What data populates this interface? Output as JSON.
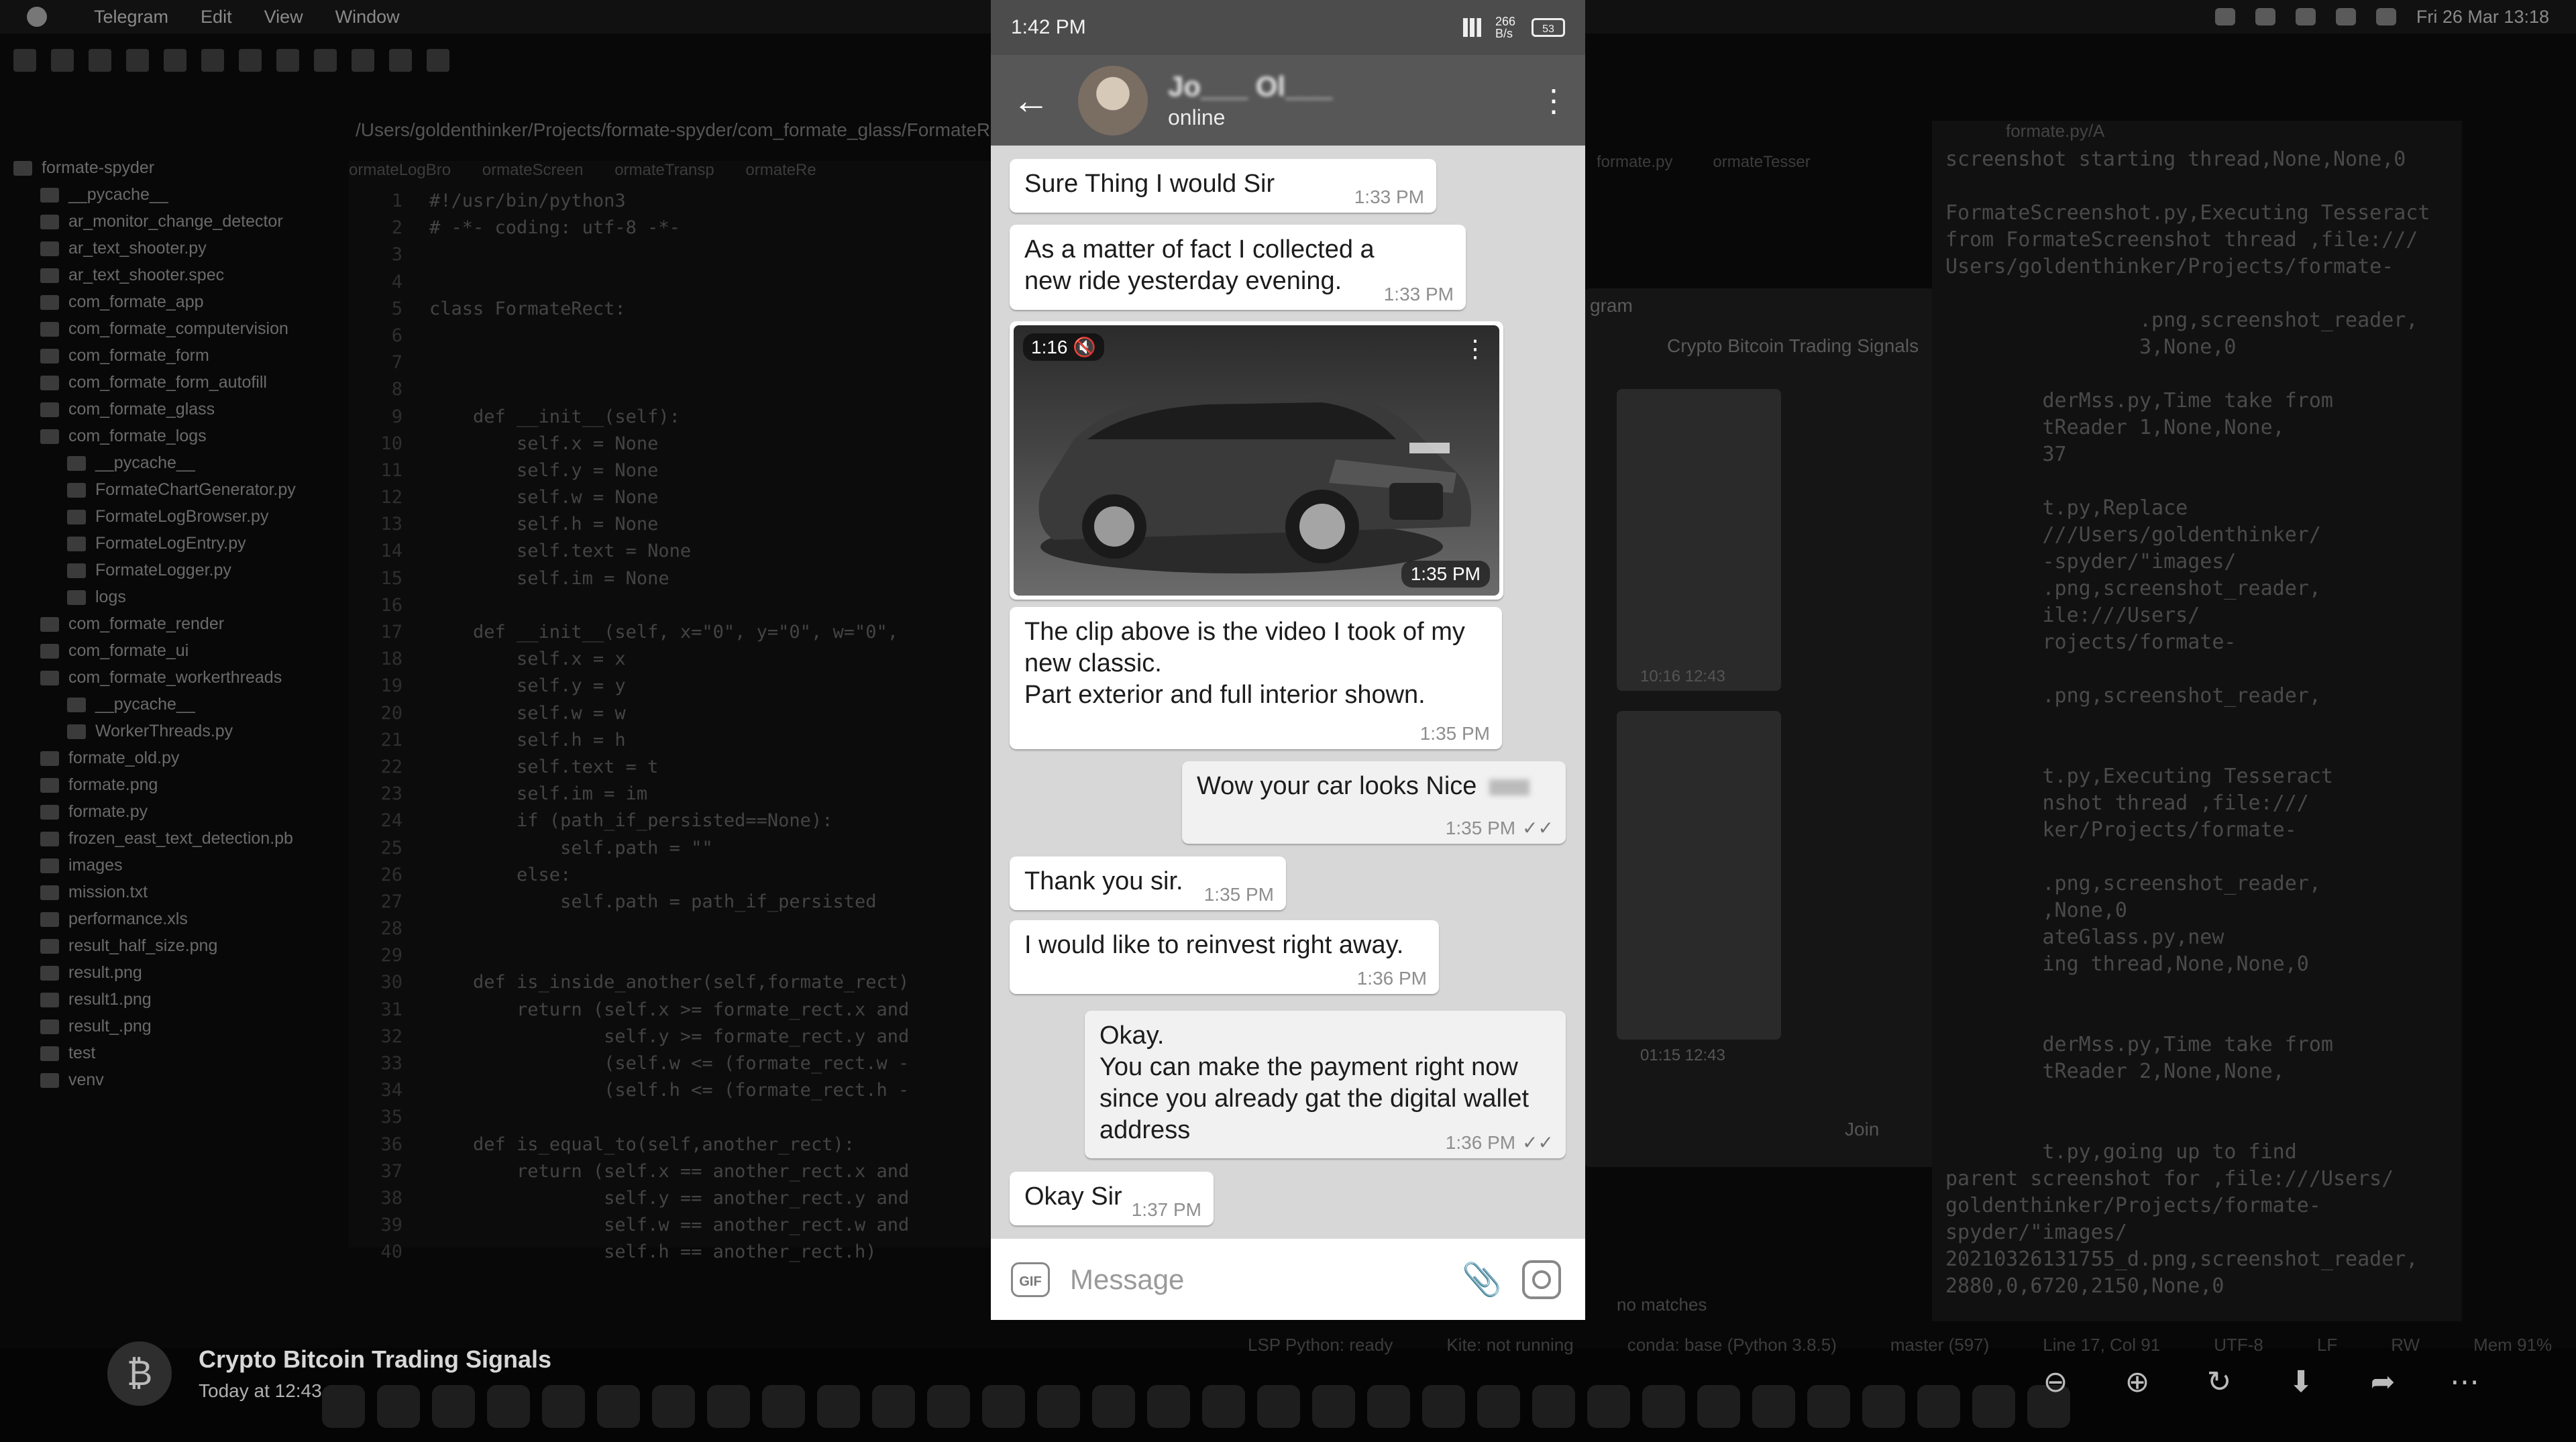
{
  "menubar": {
    "app": "Telegram",
    "items": [
      "Edit",
      "View",
      "Window"
    ],
    "clock": "Fri 26 Mar 13:18"
  },
  "ide": {
    "path": "/Users/goldenthinker/Projects/formate-spyder/com_formate_glass/FormateRe",
    "project_tree": [
      "formate-spyder",
      "__pycache__",
      "ar_monitor_change_detector",
      "ar_text_shooter.py",
      "ar_text_shooter.spec",
      "com_formate_app",
      "com_formate_computervision",
      "com_formate_form",
      "com_formate_form_autofill",
      "com_formate_glass",
      "com_formate_logs",
      "__pycache__",
      "FormateChartGenerator.py",
      "FormateLogBrowser.py",
      "FormateLogEntry.py",
      "FormateLogger.py",
      "logs",
      "com_formate_render",
      "com_formate_ui",
      "com_formate_workerthreads",
      "__pycache__",
      "WorkerThreads.py",
      "formate_old.py",
      "formate.png",
      "formate.py",
      "frozen_east_text_detection.pb",
      "images",
      "mission.txt",
      "performance.xls",
      "result_half_size.png",
      "result.png",
      "result1.png",
      "result_.png",
      "test",
      "venv"
    ],
    "editor_tabs": [
      "ormateLogBro",
      "ormateScreen",
      "ormateTransp",
      "ormateRe"
    ],
    "editor_lines": [
      [
        "1",
        "#!/usr/bin/python3"
      ],
      [
        "2",
        "# -*- coding: utf-8 -*-"
      ],
      [
        "3",
        ""
      ],
      [
        "4",
        ""
      ],
      [
        "5",
        "class FormateRect:"
      ],
      [
        "6",
        ""
      ],
      [
        "7",
        ""
      ],
      [
        "8",
        ""
      ],
      [
        "9",
        "    def __init__(self):"
      ],
      [
        "10",
        "        self.x = None"
      ],
      [
        "11",
        "        self.y = None"
      ],
      [
        "12",
        "        self.w = None"
      ],
      [
        "13",
        "        self.h = None"
      ],
      [
        "14",
        "        self.text = None"
      ],
      [
        "15",
        "        self.im = None"
      ],
      [
        "16",
        ""
      ],
      [
        "17",
        "    def __init__(self, x=\"0\", y=\"0\", w=\"0\","
      ],
      [
        "18",
        "        self.x = x"
      ],
      [
        "19",
        "        self.y = y"
      ],
      [
        "20",
        "        self.w = w"
      ],
      [
        "21",
        "        self.h = h"
      ],
      [
        "22",
        "        self.text = t"
      ],
      [
        "23",
        "        self.im = im"
      ],
      [
        "24",
        "        if (path_if_persisted==None):"
      ],
      [
        "25",
        "            self.path = \"\""
      ],
      [
        "26",
        "        else:"
      ],
      [
        "27",
        "            self.path = path_if_persisted"
      ],
      [
        "28",
        ""
      ],
      [
        "29",
        ""
      ],
      [
        "30",
        "    def is_inside_another(self,formate_rect)"
      ],
      [
        "31",
        "        return (self.x >= formate_rect.x and"
      ],
      [
        "32",
        "                self.y >= formate_rect.y and"
      ],
      [
        "33",
        "                (self.w <= (formate_rect.w -"
      ],
      [
        "34",
        "                (self.h <= (formate_rect.h -"
      ],
      [
        "35",
        ""
      ],
      [
        "36",
        "    def is_equal_to(self,another_rect):"
      ],
      [
        "37",
        "        return (self.x == another_rect.x and"
      ],
      [
        "38",
        "                self.y == another_rect.y and"
      ],
      [
        "39",
        "                self.w == another_rect.w and"
      ],
      [
        "40",
        "                self.h == another_rect.h)"
      ]
    ],
    "right_tabs": [
      "formate.py",
      "ormateTesser"
    ],
    "panel_title": "formate.py/A",
    "console_lines": [
      "screenshot starting thread,None,None,0",
      "",
      "FormateScreenshot.py,Executing Tesseract",
      "from FormateScreenshot thread ,file:///",
      "Users/goldenthinker/Projects/formate-",
      "",
      "                .png,screenshot_reader,",
      "                3,None,0",
      "",
      "        derMss.py,Time take from",
      "        tReader 1,None,None,",
      "        37",
      "",
      "        t.py,Replace",
      "        ///Users/goldenthinker/",
      "        -spyder/\"images/",
      "        .png,screenshot_reader,",
      "        ile:///Users/",
      "        rojects/formate-",
      "",
      "        .png,screenshot_reader,",
      "",
      "",
      "        t.py,Executing Tesseract",
      "        nshot thread ,file:///",
      "        ker/Projects/formate-",
      "",
      "        .png,screenshot_reader,",
      "        ,None,0",
      "        ateGlass.py,new",
      "        ing thread,None,None,0",
      "",
      "",
      "        derMss.py,Time take from",
      "        tReader 2,None,None,",
      "",
      "",
      "        t.py,going up to find",
      "parent screenshot for ,file:///Users/",
      "goldenthinker/Projects/formate-",
      "spyder/\"images/",
      "20210326131755_d.png,screenshot_reader,",
      "2880,0,6720,2150,None,0"
    ],
    "preview": {
      "app_label": "gram",
      "title": "Crypto Bitcoin Trading Signals",
      "thumb_times": [
        "10:16 12:43",
        "01:15 12:43"
      ],
      "join": "Join"
    },
    "search_status": "no matches",
    "status_bar": [
      "LSP Python: ready",
      "Kite: not running",
      "conda: base (Python 3.8.5)",
      "master (597)",
      "Line 17, Col 91",
      "UTF-8",
      "LF",
      "RW",
      "Mem 91%"
    ]
  },
  "notification": {
    "icon": "bitcoin-icon",
    "title": "Crypto Bitcoin Trading Signals",
    "time": "Today at 12:43"
  },
  "phone": {
    "status_time": "1:42 PM",
    "net_speed": "266 B/s",
    "battery": "53",
    "header": {
      "name": "Jo___ Ol___",
      "status": "online"
    },
    "media": {
      "duration": "1:16",
      "time": "1:35 PM"
    },
    "messages": [
      {
        "dir": "in",
        "text": "Sure Thing I would Sir",
        "time": "1:33 PM"
      },
      {
        "dir": "in",
        "text": "As a matter of fact I collected a new ride yesterday evening.",
        "time": "1:33 PM"
      },
      {
        "dir": "in",
        "text": "The clip above is the video I took of my new classic.\nPart exterior and full interior shown.",
        "time": "1:35 PM"
      },
      {
        "dir": "out",
        "text": "Wow your car looks Nice",
        "time": "1:35 PM"
      },
      {
        "dir": "in",
        "text": "Thank you sir.",
        "time": "1:35 PM"
      },
      {
        "dir": "in",
        "text": "I would like to reinvest right away.",
        "time": "1:36 PM"
      },
      {
        "dir": "out",
        "text": "Okay.\nYou can make the payment right now since you already gat the digital wallet address",
        "time": "1:36 PM"
      },
      {
        "dir": "in",
        "text": "Okay Sir",
        "time": "1:37 PM"
      }
    ],
    "composer": {
      "gif": "GIF",
      "placeholder": "Message"
    }
  }
}
